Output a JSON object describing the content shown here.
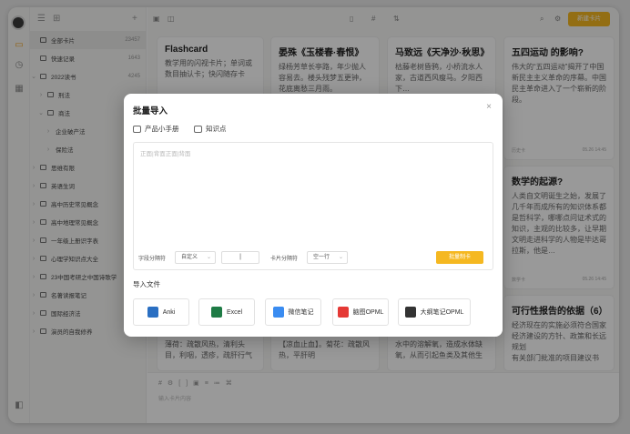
{
  "sidebar": {
    "new_symbol": "+",
    "items": [
      {
        "label": "全部卡片",
        "count": "23457",
        "selected": true
      },
      {
        "label": "快速记录",
        "count": "1643"
      },
      {
        "label": "2022读书",
        "count": "4245"
      },
      {
        "label": "刑法"
      },
      {
        "label": "商法"
      },
      {
        "label": "企业破产法"
      },
      {
        "label": "保险法"
      },
      {
        "label": "思维有限"
      },
      {
        "label": "英语生词"
      },
      {
        "label": "高中历史常见概念"
      },
      {
        "label": "高中地理常见概念"
      },
      {
        "label": "一年级上册识字表"
      },
      {
        "label": "心理学知识点大全"
      },
      {
        "label": "23中国考研之中国诗歌学"
      },
      {
        "label": "名著读报笔记"
      },
      {
        "label": "国际经济法"
      },
      {
        "label": "演员的自我修养"
      }
    ]
  },
  "header": {
    "new_button": "新建卡片"
  },
  "cards": [
    {
      "title": "Flashcard",
      "body": "教学用的闪视卡片；单词或数目抽认卡；快闪随存卡",
      "date": ""
    },
    {
      "title": "晏殊《玉楼春·春恨》",
      "body": "绿杨芳草长亭路，年少抛人容易去。楼头残梦五更钟，花底离愁三月雨。",
      "date": ""
    },
    {
      "title": "马致远《天净沙·秋思》",
      "body": "枯藤老树昏鸦，小桥流水人家，古道西风瘦马。夕阳西下…",
      "date": ""
    },
    {
      "title": "五四运动 的影响?",
      "body": "伟大的“五四运动”揭开了中国新民主主义革命的序幕。中国民主革命进入了一个崭新的阶段。",
      "tag": "历史卡",
      "date": "05.26 14:45"
    },
    {
      "title": "数学的起源?",
      "body": "人类自文明诞生之始，发展了几千年而成所有的知识体系都是哲科学，哪哪点问证术式的知识，主观的比较多，让早期文明走进科学的人物是毕达哥拉斯，他是…",
      "tag": "数学卡",
      "date": "05.26 14:45"
    },
    {
      "title": "可行性报告的依据（6）",
      "body": "经济现在的实施必须符合国家经济建设的方针、政策和长远规划",
      "foot": "有关部门批准的项目建议书",
      "date": ""
    },
    {
      "title": "",
      "body": "薄荷：疏散风热，清利头目，利咽，透疹，疏肝行气",
      "date": ""
    },
    {
      "title": "",
      "body": "【凉血止血】。菊花：疏散风热，平肝明",
      "date": ""
    },
    {
      "title": "",
      "body": "水中的溶解氧，造成水体缺氧，从而引起鱼类及其他生",
      "date": ""
    }
  ],
  "editor": {
    "placeholder": "输入卡片内容"
  },
  "modal": {
    "title": "批量导入",
    "close": "×",
    "tabs": [
      "产品小手册",
      "知识点"
    ],
    "placeholder": "正面|背面正面|背面",
    "field_sep_label": "字段分隔符",
    "field_sep_value": "自定义",
    "custom_sep": "|",
    "card_sep_label": "卡片分隔符",
    "card_sep_value": "空一行",
    "generate_button": "批量制卡",
    "import_label": "导入文件",
    "import_options": [
      {
        "label": "Anki",
        "icon": "anki-icon",
        "color": "#2a6fc2"
      },
      {
        "label": "Excel",
        "icon": "excel-icon",
        "color": "#1e7b45"
      },
      {
        "label": "微信笔记",
        "icon": "wechat-note-icon",
        "color": "#3a8cf1"
      },
      {
        "label": "脑图OPML",
        "icon": "mindmap-icon",
        "color": "#e53935"
      },
      {
        "label": "大纲笔记OPML",
        "icon": "outline-icon",
        "color": "#333333"
      }
    ]
  },
  "colors": {
    "accent": "#f5b821",
    "overlay": "rgba(0,0,0,0.40)"
  }
}
